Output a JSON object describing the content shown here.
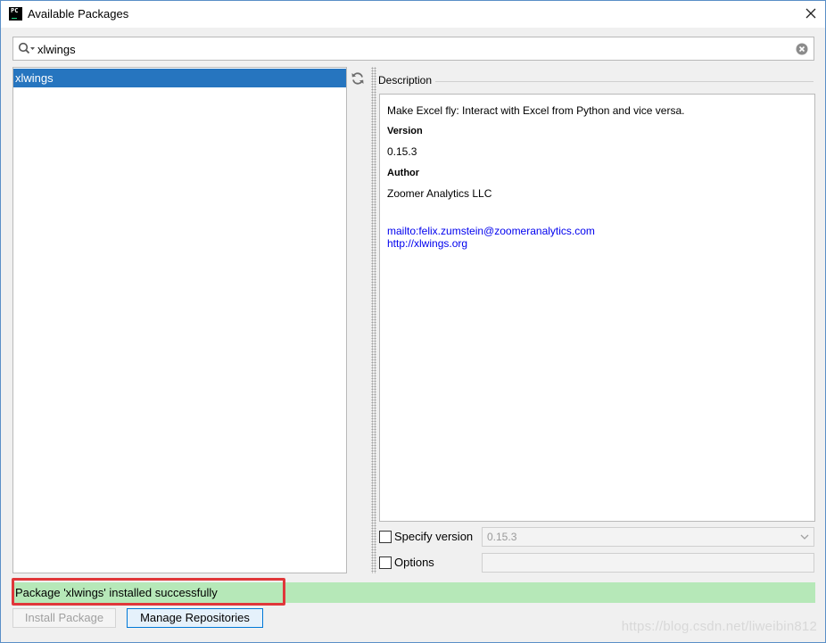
{
  "window": {
    "title": "Available Packages",
    "app_icon_text": "PC",
    "close_icon": "close-icon"
  },
  "search": {
    "value": "xlwings",
    "icon": "search-icon",
    "clear_icon": "clear-icon"
  },
  "packages": {
    "items": [
      {
        "label": "xlwings",
        "selected": true
      }
    ],
    "refresh_icon": "refresh-icon",
    "selection_color": "#2675bf"
  },
  "description": {
    "header": "Description",
    "summary": "Make Excel fly: Interact with Excel from Python and vice versa.",
    "version_label": "Version",
    "version_value": "0.15.3",
    "author_label": "Author",
    "author_value": "Zoomer Analytics LLC",
    "links": [
      "mailto:felix.zumstein@zoomeranalytics.com",
      "http://xlwings.org"
    ]
  },
  "options": {
    "specify_version_label": "Specify version",
    "specify_version_checked": false,
    "version_select_value": "0.15.3",
    "options_label": "Options",
    "options_checked": false,
    "options_value": ""
  },
  "status": {
    "message": "Package 'xlwings' installed successfully",
    "color": "#b6e8b8",
    "highlight_color": "#e0373a"
  },
  "buttons": {
    "install_label": "Install Package",
    "manage_label": "Manage Repositories"
  },
  "watermark": "https://blog.csdn.net/liweibin812"
}
